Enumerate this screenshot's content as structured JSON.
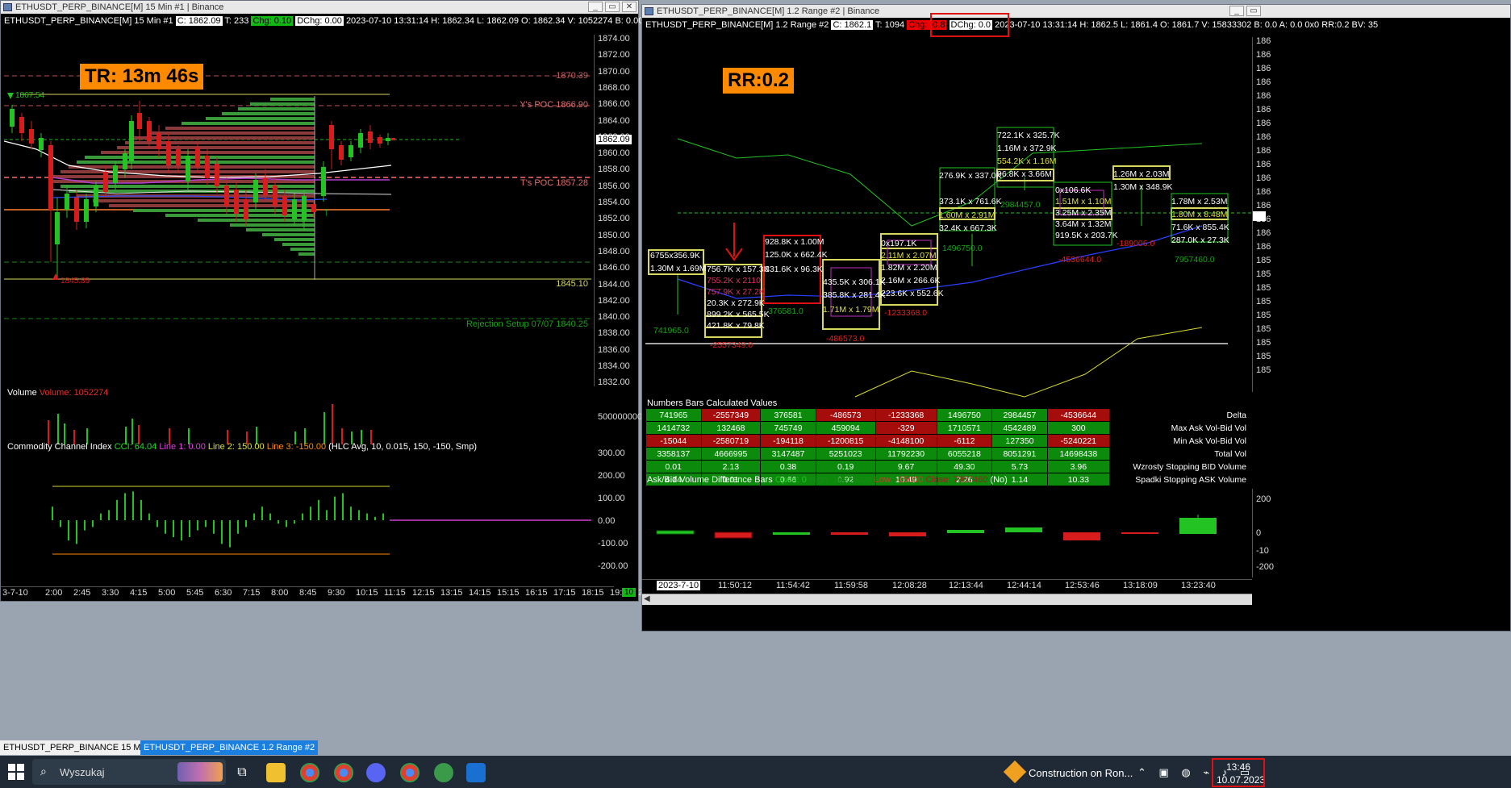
{
  "left_window": {
    "title": "ETHUSDT_PERP_BINANCE[M]  15 Min  #1 | Binance",
    "info": {
      "symbol": "ETHUSDT_PERP_BINANCE[M]  15 Min   #1",
      "close": "C: 1862.09",
      "trades": "T: 233",
      "chg": "Chg: 0.10",
      "dchg": "DChg: 0.00",
      "rest": "2023-07-10 13:31:14  H: 1862.34  L: 1862.09  O: 1862.34  V: 1052274  B: 0.00  A: 0.00  TR:"
    },
    "tr_label": "TR: 13m 46s",
    "price_axis": [
      "1874.00",
      "1872.00",
      "1870.00",
      "1868.00",
      "1866.00",
      "1864.00",
      "1862.00",
      "1860.00",
      "1858.00",
      "1856.00",
      "1854.00",
      "1852.00",
      "1850.00",
      "1848.00",
      "1846.00",
      "1844.00",
      "1842.00",
      "1840.00",
      "1838.00",
      "1836.00",
      "1834.00",
      "1832.00"
    ],
    "current_price": "1862.09",
    "levels": {
      "high_label": "1870.39",
      "ypoc": "Y's POC  1866.90",
      "tpoc": "T's POC  1857.28",
      "low_line": "1845.10",
      "rejection": "Rejection Setup 07/07  1840.25",
      "top_marker": "1867.54",
      "bottom_marker": "1845.89"
    },
    "volume": {
      "label": "Volume",
      "value": "Volume: 1052274",
      "axis": "500000000"
    },
    "cci": {
      "title": "Commodity Channel Index",
      "cci": "CCI: 64.04",
      "line1": "Line 1: 0.00",
      "line2": "Line 2: 150.00",
      "line3": "Line 3: -150.00",
      "params": "(HLC Avg, 10, 0.015, 150, -150, Smp)",
      "axis": [
        "300.00",
        "200.00",
        "100.00",
        "0.00",
        "-100.00",
        "-200.00"
      ]
    },
    "time_axis": [
      "3-7-10",
      "2:00",
      "2:45",
      "3:30",
      "4:15",
      "5:00",
      "5:45",
      "6:30",
      "7:15",
      "8:00",
      "8:45",
      "9:30",
      "10:15",
      "11:15",
      "12:15",
      "13:15",
      "14:15",
      "15:15",
      "16:15",
      "17:15",
      "18:15",
      "19:15",
      "20:15"
    ],
    "corner_badge": "10"
  },
  "right_window": {
    "title": "ETHUSDT_PERP_BINANCE[M]  1.2 Range  #2 | Binance",
    "info": {
      "symbol": "ETHUSDT_PERP_BINANCE[M]  1.2 Range  #2",
      "close": "C: 1862.1",
      "trades": "T: 1094",
      "chg": "Chg: -0.8",
      "dchg": "DChg: 0.0",
      "datetime": "2023-07-10 13:31:14",
      "rest": "H: 1862.5  L: 1861.4  O: 1861.7  V: 15833302  B: 0.0  A: 0.0  0x0  RR:0.2  BV: 35"
    },
    "rr_label": "RR:0.2",
    "footprint": [
      {
        "top": "6755x356.9K",
        "b1": "1.30M x 1.69M",
        "delta": "741965.0"
      },
      {
        "top": "756.7K x 157.3K",
        "b1": "755.2K x 2110",
        "b2": "757.9K x 27.2K",
        "b3": "20.3K x 272.9K",
        "b4": "899.2K x 565.5K",
        "b5": "421.8K x 79.8K",
        "delta": "-2557349.0"
      },
      {
        "top": "928.8K x 1.00M",
        "b1": "125.0K x 662.4K",
        "b2": "331.6K x 96.3K",
        "delta": "376581.0"
      },
      {
        "top": "435.5K x 306.1K",
        "b1": "385.8K x 281.4K",
        "b2": "1.71M x 1.79M",
        "delta": "-486573.0"
      },
      {
        "top": "0x197.1K",
        "b1": "2.11M x 2.07M",
        "b2": "1.82M x 2.20M",
        "b3": "2.16M x 266.6K",
        "b4": "223.6K x 552.6K",
        "delta": "-1233368.0"
      },
      {
        "top": "276.9K x 337.0K",
        "b1": "373.1K x 761.6K",
        "b2": "1.60M x 2.91M",
        "b3": "32.4K x 667.3K",
        "delta": "1496750.0"
      },
      {
        "top": "722.1K x 325.7K",
        "b1": "1.16M x 372.9K",
        "b2": "554.2K x 1.16M",
        "b3": "96.8K x 3.66M",
        "delta": "2984457.0"
      },
      {
        "top": "0x106.6K",
        "b1": "1.51M x 1.10M",
        "b2": "3.25M x 2.35M",
        "b3": "3.64M x 1.32M",
        "b4": "919.5K x 203.7K",
        "delta": "-4536644.0"
      },
      {
        "top": "1.26M x 2.03M",
        "b1": "1.30M x 348.9K",
        "delta": "-189006.0"
      },
      {
        "top": "1.78M x 2.53M",
        "b1": "1.80M x 8.48M",
        "b2": "71.6K x 855.4K",
        "b3": "287.0K x 27.3K",
        "delta": "7957460.0"
      }
    ],
    "calc_title": "Numbers Bars Calculated Values",
    "calc_rows": [
      {
        "name": "Delta",
        "vals": [
          "741965",
          "-2557349",
          "376581",
          "-486573",
          "-1233368",
          "1496750",
          "2984457",
          "-4536644"
        ]
      },
      {
        "name": "Max Ask Vol-Bid Vol",
        "vals": [
          "1414732",
          "132468",
          "745749",
          "459094",
          "-329",
          "1710571",
          "4542489",
          "300"
        ]
      },
      {
        "name": "Min Ask Vol-Bid Vol",
        "vals": [
          "-15044",
          "-2580719",
          "-194118",
          "-1200815",
          "-4148100",
          "-6112",
          "127350",
          "-5240221"
        ]
      },
      {
        "name": "Total Vol",
        "vals": [
          "3358137",
          "4666995",
          "3147487",
          "5251023",
          "11792230",
          "6055218",
          "8051291",
          "14698438"
        ]
      },
      {
        "name": "Wzrosty Stopping BID Volume",
        "vals": [
          "0.01",
          "2.13",
          "0.38",
          "0.19",
          "9.67",
          "49.30",
          "5.73",
          "3.96"
        ]
      },
      {
        "name": "Spadki Stopping ASK Volume",
        "vals": [
          "4.74",
          "0.01",
          "0.66",
          "0.92",
          "10.49",
          "2.26",
          "1.14",
          "10.33"
        ]
      }
    ],
    "diff_title": "Ask/Bid Volume Difference Bars",
    "diff_open": "Open: 0",
    "diff_high": "High: 10525038",
    "diff_low": "Low: -15000",
    "diff_close": "Close: 7957460",
    "diff_no": "(No)",
    "time_axis": [
      "2023-7-10",
      "11:50:12",
      "11:54:42",
      "11:59:58",
      "12:08:28",
      "12:13:44",
      "12:44:14",
      "12:53:46",
      "13:18:09",
      "13:23:40"
    ],
    "diff_axis": [
      "200",
      "0",
      "-10",
      "-200"
    ],
    "price_axis": [
      "186",
      "186",
      "186",
      "186",
      "186",
      "186",
      "186",
      "186",
      "186",
      "186",
      "186",
      "186",
      "186",
      "186",
      "186",
      "186",
      "185",
      "185",
      "185",
      "185",
      "185",
      "185",
      "185",
      "185",
      "185"
    ]
  },
  "tabs": [
    "ETHUSDT_PERP_BINANCE  15 Min  #1",
    "ETHUSDT_PERP_BINANCE  1.2 Range  #2"
  ],
  "taskbar": {
    "search": "Wyszukaj",
    "notification": "Construction on Ron...",
    "time": "13:46",
    "date": "10.07.2023"
  },
  "colors": {
    "accent_orange": "#ff8a00",
    "up": "#22c322",
    "down": "#d61c1c",
    "cell_green": "#0b8a0b",
    "cell_red": "#a50d0d"
  }
}
